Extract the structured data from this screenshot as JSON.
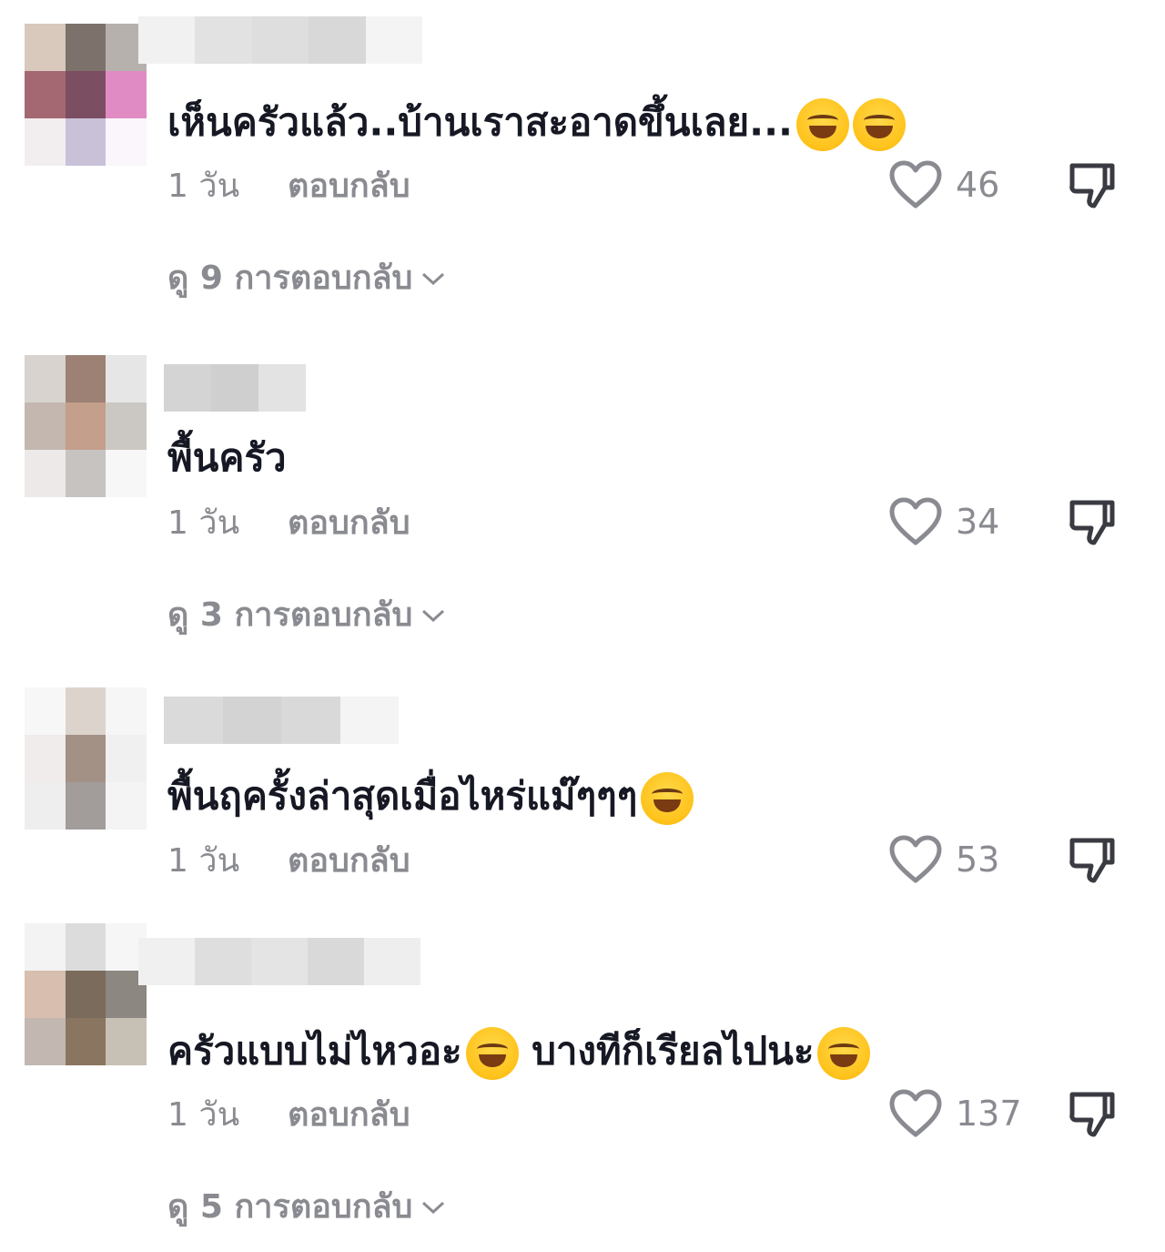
{
  "comments": [
    {
      "text": "เห็นครัวแล้ว..บ้านเราสะอาดขึ้นเลย...",
      "emoji_count": 2,
      "time": "1 วัน",
      "reply_label": "ตอบกลับ",
      "likes": "46",
      "view_replies": "ดู 9 การตอบกลับ"
    },
    {
      "text": "พื้นครัว",
      "emoji_count": 0,
      "time": "1 วัน",
      "reply_label": "ตอบกลับ",
      "likes": "34",
      "view_replies": "ดู 3 การตอบกลับ"
    },
    {
      "text": "พื้นฤครั้งล่าสุดเมื่อไหร่แม๊ๆๆๆ",
      "emoji_count": 1,
      "time": "1 วัน",
      "reply_label": "ตอบกลับ",
      "likes": "53",
      "view_replies": ""
    },
    {
      "text_a": "ครัวแบบไม่ไหวอะ",
      "text_b": " บางทีก็เรียลไปนะ",
      "emoji_count": 2,
      "time": "1 วัน",
      "reply_label": "ตอบกลับ",
      "likes": "137",
      "view_replies": "ดู 5 การตอบกลับ"
    }
  ],
  "icons": {
    "like": "heart-outline-icon",
    "dislike": "thumbs-down-outline-icon",
    "expand": "chevron-down-icon",
    "emoji_laugh": "face-with-tears-of-joy-emoji",
    "emoji_rofl": "rolling-on-floor-laughing-emoji"
  },
  "colors": {
    "text_primary": "#161823",
    "text_secondary": "#8a8b91",
    "background": "#ffffff"
  }
}
